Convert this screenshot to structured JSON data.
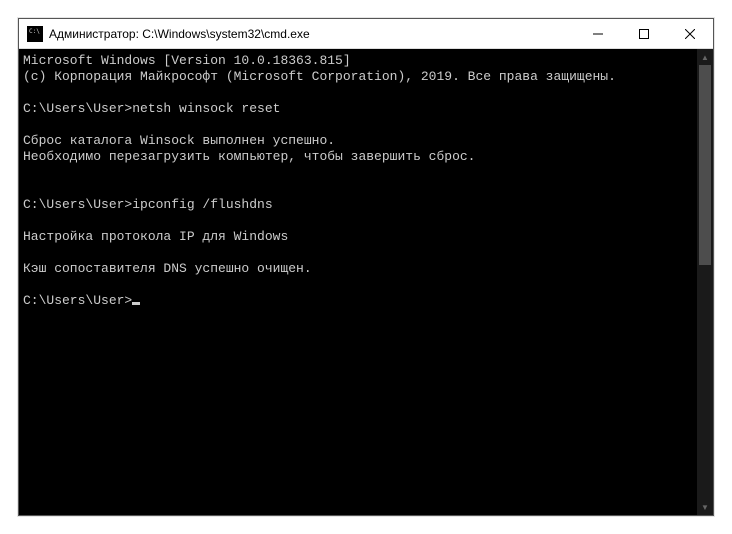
{
  "window": {
    "title": "Администратор: C:\\Windows\\system32\\cmd.exe"
  },
  "terminal": {
    "lines": [
      "Microsoft Windows [Version 10.0.18363.815]",
      "(c) Корпорация Майкрософт (Microsoft Corporation), 2019. Все права защищены.",
      "",
      "C:\\Users\\User>netsh winsock reset",
      "",
      "Сброс каталога Winsock выполнен успешно.",
      "Необходимо перезагрузить компьютер, чтобы завершить сброс.",
      "",
      "",
      "C:\\Users\\User>ipconfig /flushdns",
      "",
      "Настройка протокола IP для Windows",
      "",
      "Кэш сопоставителя DNS успешно очищен.",
      "",
      "C:\\Users\\User>"
    ]
  }
}
